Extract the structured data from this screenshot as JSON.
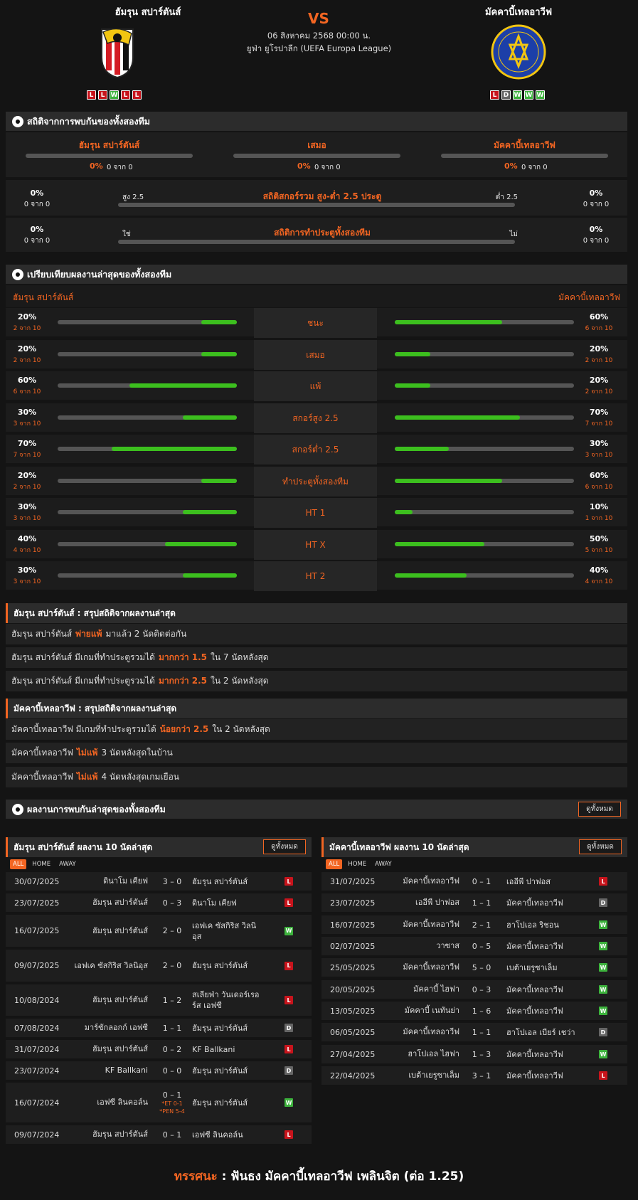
{
  "match": {
    "home": "ฮัมรุน สปาร์ตันส์",
    "away": "มัคคาบี้เทลอาวีฟ",
    "vs": "VS",
    "date": "06 สิงหาคม 2568 00:00 น.",
    "league": "ยูฟ่า ยูโรปาลีก (UEFA Europa League)",
    "home_form": [
      "L",
      "L",
      "W",
      "L",
      "L"
    ],
    "away_form": [
      "L",
      "D",
      "W",
      "W",
      "W"
    ]
  },
  "h2h": {
    "title": "สถิติจากการพบกันของทั้งสองทีม",
    "cols": [
      {
        "label": "ฮัมรุน สปาร์ตันส์",
        "pct": "0%",
        "sub": "0 จาก 0"
      },
      {
        "label": "เสมอ",
        "pct": "0%",
        "sub": "0 จาก 0"
      },
      {
        "label": "มัคคาบี้เทลอาวีฟ",
        "pct": "0%",
        "sub": "0 จาก 0"
      }
    ],
    "ou": {
      "title": "สถิติสกอร์รวม สูง-ต่ำ 2.5 ประตู",
      "left_label": "สูง 2.5",
      "right_label": "ต่ำ 2.5",
      "lpct": "0%",
      "lsub": "0 จาก 0",
      "rpct": "0%",
      "rsub": "0 จาก 0"
    },
    "btts": {
      "title": "สถิติการทำประตูทั้งสองทีม",
      "left_label": "ใช่",
      "right_label": "ไม่",
      "lpct": "0%",
      "lsub": "0 จาก 0",
      "rpct": "0%",
      "rsub": "0 จาก 0"
    }
  },
  "compare": {
    "title": "เปรียบเทียบผลงานล่าสุดของทั้งสองทีม",
    "home": "ฮัมรุน สปาร์ตันส์",
    "away": "มัคคาบี้เทลอาวีฟ",
    "rows": [
      {
        "label": "ชนะ",
        "hp": "20%",
        "hs": "2 จาก 10",
        "hv": 0.2,
        "ap": "60%",
        "as": "6 จาก 10",
        "av": 0.6
      },
      {
        "label": "เสมอ",
        "hp": "20%",
        "hs": "2 จาก 10",
        "hv": 0.2,
        "ap": "20%",
        "as": "2 จาก 10",
        "av": 0.2
      },
      {
        "label": "แพ้",
        "hp": "60%",
        "hs": "6 จาก 10",
        "hv": 0.6,
        "ap": "20%",
        "as": "2 จาก 10",
        "av": 0.2
      },
      {
        "label": "สกอร์สูง 2.5",
        "hp": "30%",
        "hs": "3 จาก 10",
        "hv": 0.3,
        "ap": "70%",
        "as": "7 จาก 10",
        "av": 0.7
      },
      {
        "label": "สกอร์ต่ำ 2.5",
        "hp": "70%",
        "hs": "7 จาก 10",
        "hv": 0.7,
        "ap": "30%",
        "as": "3 จาก 10",
        "av": 0.3
      },
      {
        "label": "ทำประตูทั้งสองทีม",
        "hp": "20%",
        "hs": "2 จาก 10",
        "hv": 0.2,
        "ap": "60%",
        "as": "6 จาก 10",
        "av": 0.6
      },
      {
        "label": "HT 1",
        "hp": "30%",
        "hs": "3 จาก 10",
        "hv": 0.3,
        "ap": "10%",
        "as": "1 จาก 10",
        "av": 0.1
      },
      {
        "label": "HT X",
        "hp": "40%",
        "hs": "4 จาก 10",
        "hv": 0.4,
        "ap": "50%",
        "as": "5 จาก 10",
        "av": 0.5
      },
      {
        "label": "HT 2",
        "hp": "30%",
        "hs": "3 จาก 10",
        "hv": 0.3,
        "ap": "40%",
        "as": "4 จาก 10",
        "av": 0.4
      }
    ]
  },
  "summary_home": {
    "title": "ฮัมรุน สปาร์ตันส์ : สรุปสถิติจากผลงานล่าสุด",
    "rows": [
      {
        "pre": "ฮัมรุน สปาร์ตันส์",
        "hl": "พ่ายแพ้",
        "post": "มาแล้ว 2 นัดติดต่อกัน"
      },
      {
        "pre": "ฮัมรุน สปาร์ตันส์ มีเกมที่ทำประตูรวมได้",
        "hl": "มากกว่า 1.5",
        "post": "ใน 7 นัดหลังสุด"
      },
      {
        "pre": "ฮัมรุน สปาร์ตันส์ มีเกมที่ทำประตูรวมได้",
        "hl": "มากกว่า 2.5",
        "post": "ใน 2 นัดหลังสุด"
      }
    ]
  },
  "summary_away": {
    "title": "มัคคาบี้เทลอาวีฟ : สรุปสถิติจากผลงานล่าสุด",
    "rows": [
      {
        "pre": "มัคคาบี้เทลอาวีฟ มีเกมที่ทำประตูรวมได้",
        "hl": "น้อยกว่า 2.5",
        "post": "ใน 2 นัดหลังสุด"
      },
      {
        "pre": "มัคคาบี้เทลอาวีฟ",
        "hl": "ไม่แพ้",
        "post": "3 นัดหลังสุดในบ้าน"
      },
      {
        "pre": "มัคคาบี้เทลอาวีฟ",
        "hl": "ไม่แพ้",
        "post": "4 นัดหลังสุดเกมเยือน"
      }
    ]
  },
  "recent": {
    "title": "ผลงานการพบกันล่าสุดของทั้งสองทีม",
    "view_all": "ดูทั้งหมด",
    "tabs": [
      "ALL",
      "HOME",
      "AWAY"
    ],
    "home_title": "ฮัมรุน สปาร์ตันส์ ผลงาน 10 นัดล่าสุด",
    "away_title": "มัคคาบี้เทลอาวีฟ ผลงาน 10 นัดล่าสุด",
    "home_matches": [
      {
        "date": "30/07/2025",
        "home": "ดินาโม เคียฟ",
        "score": "3 – 0",
        "away": "ฮัมรุน สปาร์ตันส์",
        "res": "L"
      },
      {
        "date": "23/07/2025",
        "home": "ฮัมรุน สปาร์ตันส์",
        "score": "0 – 3",
        "away": "ดินาโม เคียฟ",
        "res": "L"
      },
      {
        "date": "16/07/2025",
        "home": "ฮัมรุน สปาร์ตันส์",
        "score": "2 – 0",
        "away": "เอฟเค ซัสกิริส วิลนิอุส",
        "res": "W"
      },
      {
        "date": "09/07/2025",
        "home": "เอฟเค ซัสกิริส วิลนิอุส",
        "score": "2 – 0",
        "away": "ฮัมรุน สปาร์ตันส์",
        "res": "L"
      },
      {
        "date": "10/08/2024",
        "home": "ฮัมรุน สปาร์ตันส์",
        "score": "1 – 2",
        "away": "สเลียฟ่า วันเดอร์เรอร์ส เอฟซี",
        "res": "L"
      },
      {
        "date": "07/08/2024",
        "home": "มาร์ซักลอกก์ เอฟซี",
        "score": "1 – 1",
        "away": "ฮัมรุน สปาร์ตันส์",
        "res": "D"
      },
      {
        "date": "31/07/2024",
        "home": "ฮัมรุน สปาร์ตันส์",
        "score": "0 – 2",
        "away": "KF Ballkani",
        "res": "L"
      },
      {
        "date": "23/07/2024",
        "home": "KF Ballkani",
        "score": "0 – 0",
        "away": "ฮัมรุน สปาร์ตันส์",
        "res": "D"
      },
      {
        "date": "16/07/2024",
        "home": "เอฟซี ลินคอล์น",
        "score": "0 – 1",
        "pen": "*ET 0-1 *PEN 5-4",
        "away": "ฮัมรุน สปาร์ตันส์",
        "res": "W"
      },
      {
        "date": "09/07/2024",
        "home": "ฮัมรุน สปาร์ตันส์",
        "score": "0 – 1",
        "away": "เอฟซี ลินคอล์น",
        "res": "L"
      }
    ],
    "away_matches": [
      {
        "date": "31/07/2025",
        "home": "มัคคาบี้เทลอาวีฟ",
        "score": "0 – 1",
        "away": "เออีพี ปาฟอส",
        "res": "L"
      },
      {
        "date": "23/07/2025",
        "home": "เออีพี ปาฟอส",
        "score": "1 – 1",
        "away": "มัคคาบี้เทลอาวีฟ",
        "res": "D"
      },
      {
        "date": "16/07/2025",
        "home": "มัคคาบี้เทลอาวีฟ",
        "score": "2 – 1",
        "away": "ฮาโปเอล ริชอน",
        "res": "W"
      },
      {
        "date": "02/07/2025",
        "home": "วาซาส",
        "score": "0 – 5",
        "away": "มัคคาบี้เทลอาวีฟ",
        "res": "W"
      },
      {
        "date": "25/05/2025",
        "home": "มัคคาบี้เทลอาวีฟ",
        "score": "5 – 0",
        "away": "เบต้าเยรูซาเล็ม",
        "res": "W"
      },
      {
        "date": "20/05/2025",
        "home": "มัคคาบี้ ไฮฟา",
        "score": "0 – 3",
        "away": "มัคคาบี้เทลอาวีฟ",
        "res": "W"
      },
      {
        "date": "13/05/2025",
        "home": "มัคคาบี้ เนทันย่า",
        "score": "1 – 6",
        "away": "มัคคาบี้เทลอาวีฟ",
        "res": "W"
      },
      {
        "date": "06/05/2025",
        "home": "มัคคาบี้เทลอาวีฟ",
        "score": "1 – 1",
        "away": "ฮาโปเอล เบียร์ เชว่า",
        "res": "D"
      },
      {
        "date": "27/04/2025",
        "home": "ฮาโปเอล ไฮฟา",
        "score": "1 – 3",
        "away": "มัคคาบี้เทลอาวีฟ",
        "res": "W"
      },
      {
        "date": "22/04/2025",
        "home": "เบต้าเยรูซาเล็ม",
        "score": "3 – 1",
        "away": "มัคคาบี้เทลอาวีฟ",
        "res": "L"
      }
    ]
  },
  "verdict": {
    "label": "ทรรศนะ",
    "sep": ":",
    "text": "ฟันธง มัคคาบี้เทลอาวีฟ เพลินจิต (ต่อ 1.25)"
  },
  "colors": {
    "accent": "#f26522",
    "green": "#3cbf1e",
    "loss": "#c8141c",
    "win": "#3db33d",
    "draw": "#666666"
  }
}
